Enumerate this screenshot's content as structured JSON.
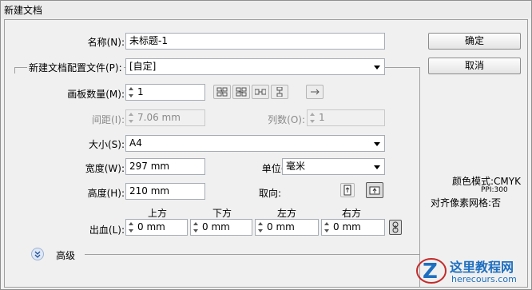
{
  "window": {
    "title": "新建文档"
  },
  "name_field": {
    "label": "名称(N):",
    "value": "未标题-1"
  },
  "profile": {
    "label": "新建文档配置文件(P):",
    "value": "[自定]"
  },
  "artboards": {
    "label": "画板数量(M):",
    "value": "1"
  },
  "spacing": {
    "label": "间距(I):",
    "value": "7.06 mm"
  },
  "columns": {
    "label": "列数(O):",
    "value": "1"
  },
  "size": {
    "label": "大小(S):",
    "value": "A4"
  },
  "width": {
    "label": "宽度(W):",
    "value": "297 mm"
  },
  "units": {
    "label": "单位(U):",
    "value": "毫米"
  },
  "height": {
    "label": "高度(H):",
    "value": "210 mm"
  },
  "orientation": {
    "label": "取向:"
  },
  "bleed": {
    "label": "出血(L):",
    "top_label": "上方",
    "top_value": "0 mm",
    "bottom_label": "下方",
    "bottom_value": "0 mm",
    "left_label": "左方",
    "left_value": "0 mm",
    "right_label": "右方",
    "right_value": "0 mm"
  },
  "advanced": {
    "label": "高级"
  },
  "buttons": {
    "ok": "确定",
    "cancel": "取消"
  },
  "info": {
    "color_mode": "颜色模式:CMYK",
    "ppi": "PPI:300",
    "pixel_grid": "对齐像素网格:否"
  },
  "watermark": {
    "title": "这里教程网",
    "url": "herecours.com"
  },
  "icons": {
    "grid_by_row": "grid-by-row-icon",
    "grid_by_column": "grid-by-column-icon",
    "arrange_by_row": "arrange-by-row-icon",
    "arrange_by_column": "arrange-by-column-icon",
    "layout_direction": "arrow-right-icon",
    "portrait": "portrait-icon",
    "landscape": "landscape-icon",
    "link": "link-icon",
    "expand": "expand-chevron-icon"
  },
  "colors": {
    "accent": "#1e6fc0",
    "background": "#f0f0f0"
  }
}
